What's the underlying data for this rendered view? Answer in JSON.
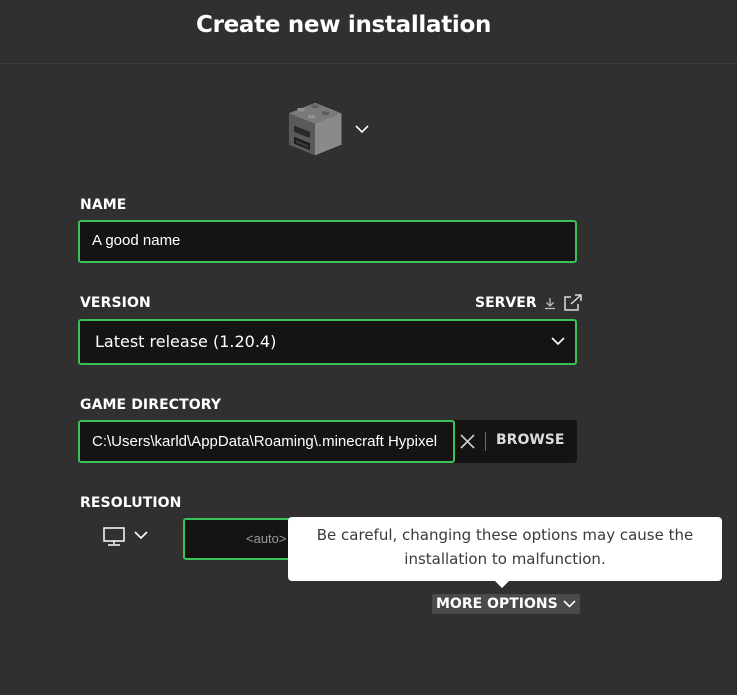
{
  "header": {
    "title": "Create new installation"
  },
  "icon_picker": {
    "icon": "furnace-icon"
  },
  "name": {
    "label": "NAME",
    "value": "A good name"
  },
  "version": {
    "label": "VERSION",
    "server_label": "SERVER",
    "selected": "Latest release (1.20.4)"
  },
  "game_directory": {
    "label": "GAME DIRECTORY",
    "value": "C:\\Users\\karld\\AppData\\Roaming\\.minecraft Hypixel",
    "browse_label": "BROWSE"
  },
  "resolution": {
    "label": "RESOLUTION",
    "width_placeholder": "<auto>"
  },
  "tooltip": {
    "line1": "Be careful, changing these options may cause the",
    "line2": "installation to malfunction."
  },
  "more_options": {
    "label": "MORE OPTIONS"
  },
  "colors": {
    "background": "#303030",
    "field_bg": "#141414",
    "accent": "#3ac15a"
  }
}
